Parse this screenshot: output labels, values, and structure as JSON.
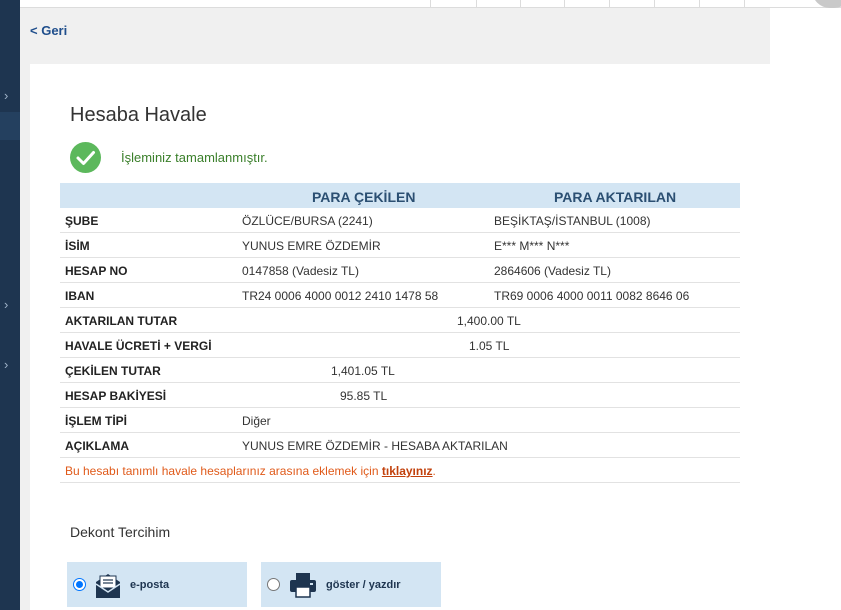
{
  "nav": {
    "back_label": "< Geri"
  },
  "page": {
    "title": "Hesaba Havale",
    "success_message": "İşleminiz tamamlanmıştır."
  },
  "table": {
    "headers": {
      "from": "PARA ÇEKİLEN",
      "to": "PARA AKTARILAN"
    },
    "rows": {
      "sube": {
        "label": "ŞUBE",
        "from": "ÖZLÜCE/BURSA (2241)",
        "to": "BEŞİKTAŞ/İSTANBUL (1008)"
      },
      "isim": {
        "label": "İSİM",
        "from": "YUNUS EMRE ÖZDEMİR",
        "to": "E*** M*** N***"
      },
      "hesap_no": {
        "label": "HESAP NO",
        "from": "0147858 (Vadesiz TL)",
        "to": "2864606 (Vadesiz TL)"
      },
      "iban": {
        "label": "IBAN",
        "from": "TR24 0006 4000 0012 2410 1478 58",
        "to": "TR69 0006 4000 0011 0082 8646 06"
      },
      "aktarilan_tutar": {
        "label": "AKTARILAN TUTAR",
        "value": "1,400.00 TL"
      },
      "havale_ucreti": {
        "label": "HAVALE ÜCRETİ + VERGİ",
        "value": "1.05 TL"
      },
      "cekilen_tutar": {
        "label": "ÇEKİLEN TUTAR",
        "value": "1,401.05 TL"
      },
      "hesap_bakiyesi": {
        "label": "HESAP BAKİYESİ",
        "value": "95.85 TL"
      },
      "islem_tipi": {
        "label": "İŞLEM TİPİ",
        "value": "Diğer"
      },
      "aciklama": {
        "label": "AÇIKLAMA",
        "value": "YUNUS EMRE ÖZDEMİR - HESABA AKTARILAN"
      }
    },
    "info": {
      "text": "Bu hesabı tanımlı havale hesaplarınız arasına eklemek için",
      "link": "tıklayınız",
      "suffix": "."
    }
  },
  "dekont": {
    "title": "Dekont Tercihim",
    "options": [
      {
        "label": "e-posta",
        "selected": true,
        "icon": "envelope-icon"
      },
      {
        "label": "göster / yazdır",
        "selected": false,
        "icon": "printer-icon"
      }
    ]
  },
  "colors": {
    "header_bg": "#d3e5f3",
    "header_text": "#2b4f72",
    "success": "#5cb85c",
    "info_text": "#e05a1a",
    "rail": "#1e3550"
  }
}
